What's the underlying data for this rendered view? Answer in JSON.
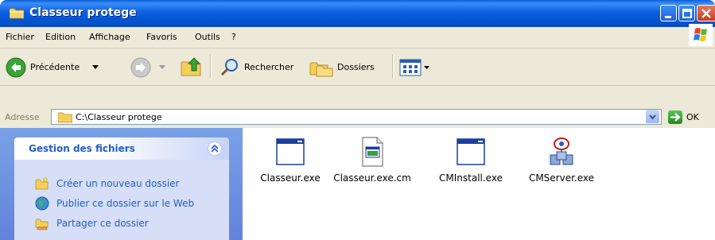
{
  "window": {
    "title": "Classeur protege"
  },
  "menubar": {
    "items": [
      "Fichier",
      "Edition",
      "Affichage",
      "Favoris",
      "Outils",
      "?"
    ]
  },
  "toolbar": {
    "back_label": "Précédente",
    "search_label": "Rechercher",
    "folders_label": "Dossiers"
  },
  "address": {
    "label": "Adresse",
    "path": "C:\\Classeur protege",
    "go_label": "OK"
  },
  "task_pane": {
    "title": "Gestion des fichiers",
    "links": [
      {
        "label": "Créer un nouveau dossier",
        "icon": "new-folder-icon"
      },
      {
        "label": "Publier ce dossier sur le Web",
        "icon": "publish-web-icon"
      },
      {
        "label": "Partager ce dossier",
        "icon": "share-folder-icon"
      }
    ]
  },
  "files": [
    {
      "name": "Classeur.exe",
      "icon": "application-window-icon"
    },
    {
      "name": "Classeur.exe.cm",
      "icon": "document-file-icon"
    },
    {
      "name": "CMInstall.exe",
      "icon": "application-window-icon"
    },
    {
      "name": "CMServer.exe",
      "icon": "network-server-icon"
    }
  ],
  "colors": {
    "titlebar": "#0553cf",
    "chrome": "#ece9d8",
    "task_link": "#215dc6",
    "task_bg": "#d6dff7"
  }
}
